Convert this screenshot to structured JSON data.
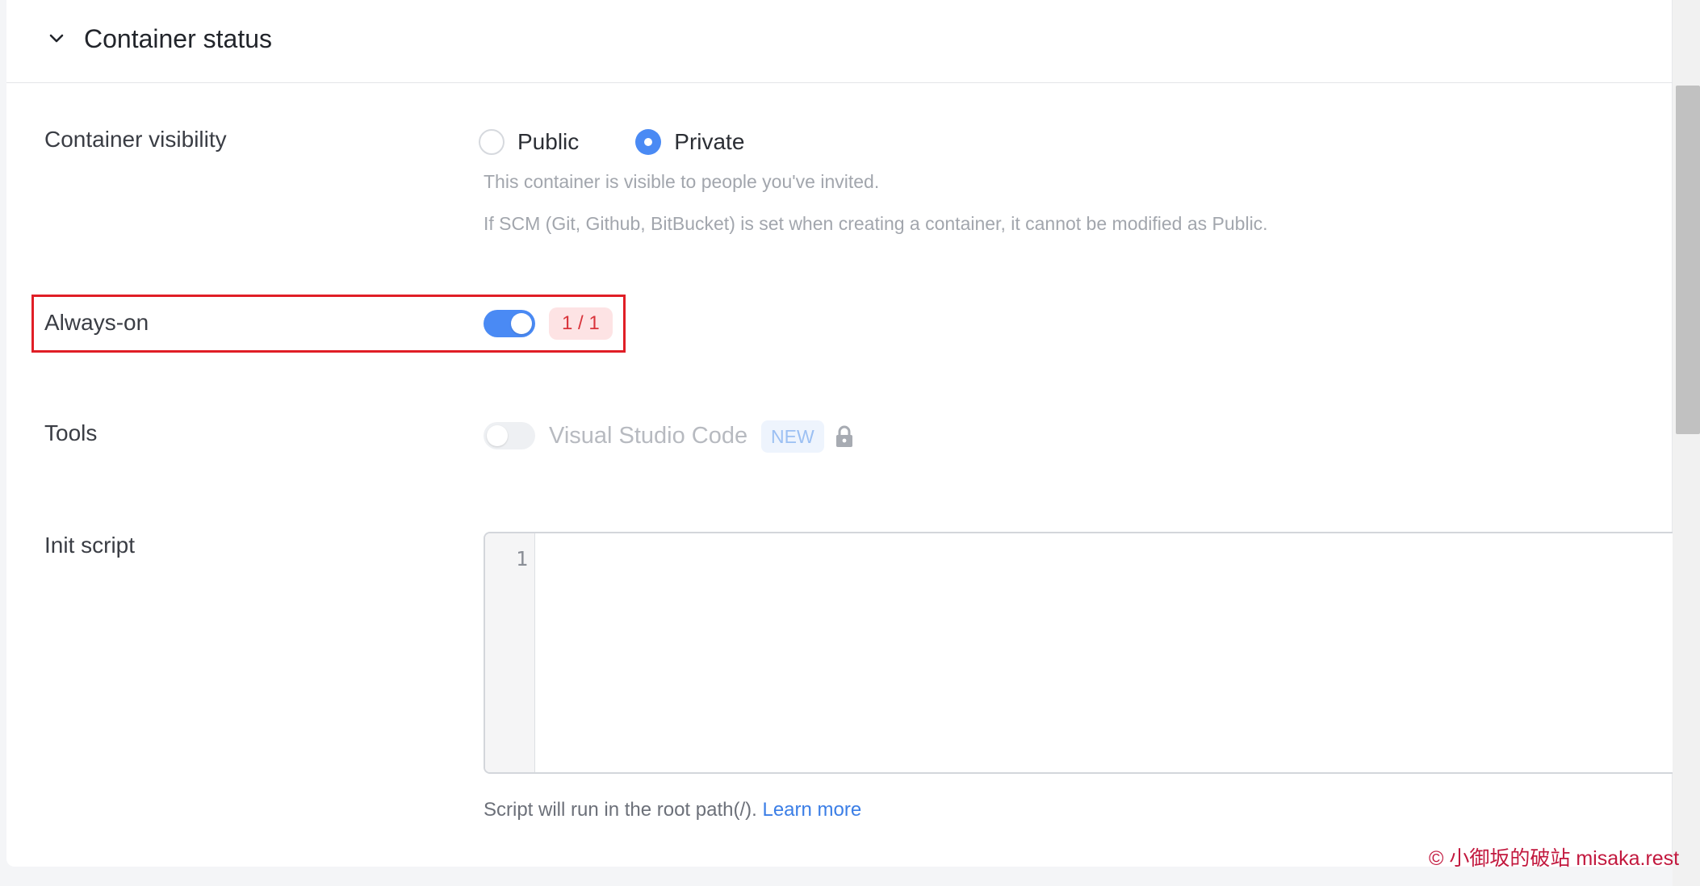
{
  "section": {
    "title": "Container status"
  },
  "visibility": {
    "label": "Container visibility",
    "options": [
      {
        "label": "Public",
        "checked": false
      },
      {
        "label": "Private",
        "checked": true
      }
    ],
    "help_line_1": "This container is visible to people you've invited.",
    "help_line_2": "If SCM (Git, Github, BitBucket) is set when creating a container, it cannot be modified as Public."
  },
  "always_on": {
    "label": "Always-on",
    "enabled": true,
    "count": "1 / 1"
  },
  "tools": {
    "label": "Tools",
    "item_label": "Visual Studio Code",
    "badge": "NEW",
    "enabled": false,
    "locked": true
  },
  "init_script": {
    "label": "Init script",
    "line_number": "1",
    "content": "",
    "help_text": "Script will run in the root path(/).",
    "link_text": "Learn more"
  },
  "watermark": "© 小御坂的破站 misaka.rest",
  "colors": {
    "accent": "#4a8af4",
    "highlight_border": "#e01e26",
    "count_badge_bg": "#fde3e4",
    "count_badge_text": "#d9343b",
    "link": "#3b7ee6",
    "watermark": "#c2183e"
  },
  "icons": {
    "collapse": "chevron-down-icon",
    "lock": "lock-icon"
  }
}
